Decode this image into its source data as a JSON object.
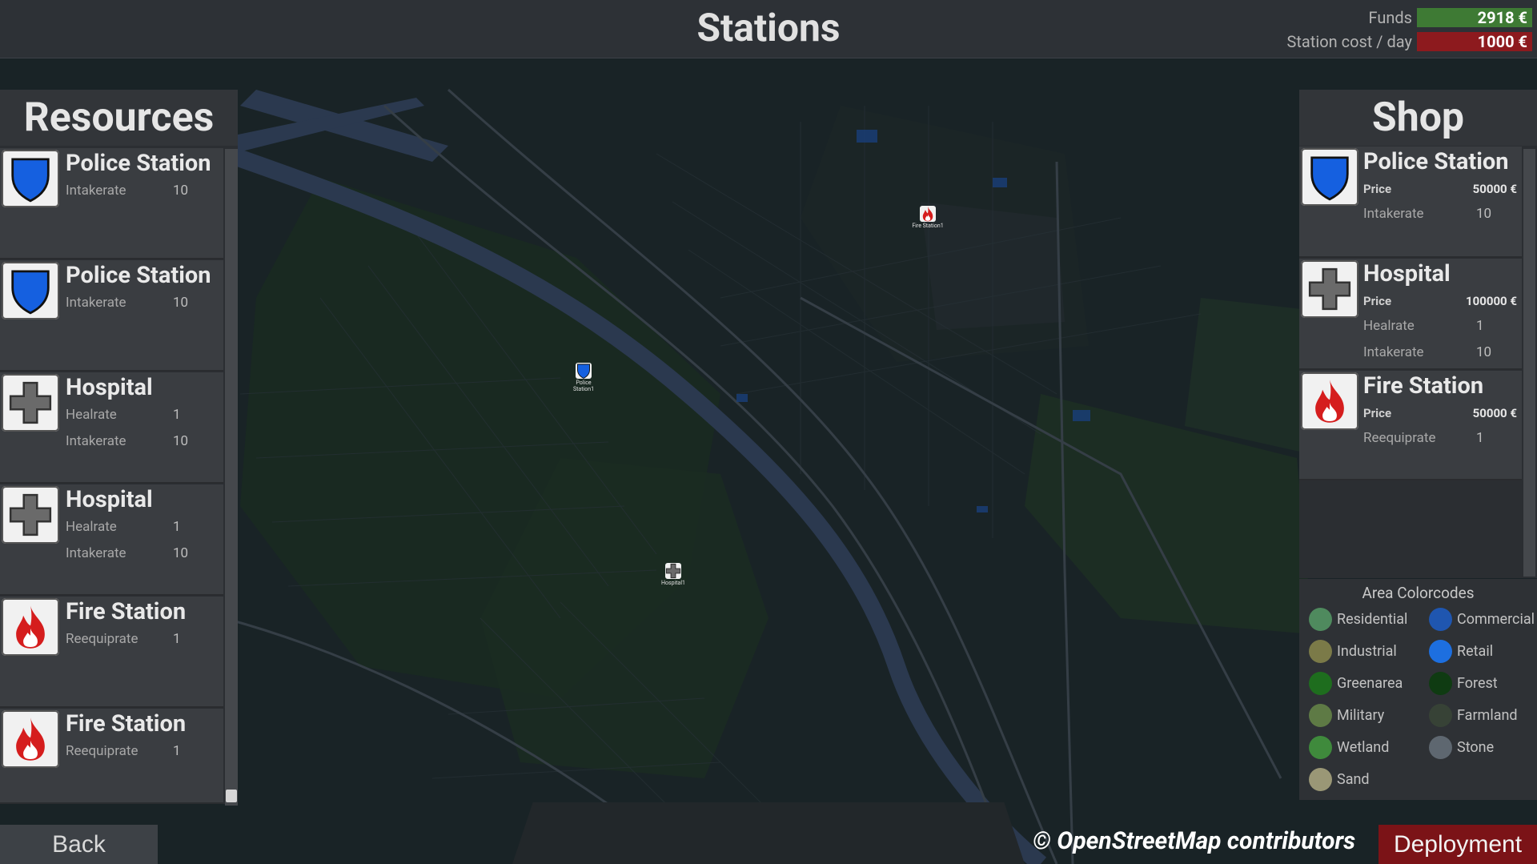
{
  "header": {
    "title": "Stations",
    "funds_label": "Funds",
    "funds_value": "2918 €",
    "cost_label": "Station cost / day",
    "cost_value": "1000 €"
  },
  "resources": {
    "title": "Resources",
    "items": [
      {
        "icon": "police-shield-icon",
        "name": "Police Station",
        "attrs": [
          {
            "label": "Intakerate",
            "value": "10"
          }
        ]
      },
      {
        "icon": "police-shield-icon",
        "name": "Police Station",
        "attrs": [
          {
            "label": "Intakerate",
            "value": "10"
          }
        ]
      },
      {
        "icon": "hospital-cross-icon",
        "name": "Hospital",
        "attrs": [
          {
            "label": "Healrate",
            "value": "1"
          },
          {
            "label": "Intakerate",
            "value": "10"
          }
        ]
      },
      {
        "icon": "hospital-cross-icon",
        "name": "Hospital",
        "attrs": [
          {
            "label": "Healrate",
            "value": "1"
          },
          {
            "label": "Intakerate",
            "value": "10"
          }
        ]
      },
      {
        "icon": "fire-flame-icon",
        "name": "Fire Station",
        "attrs": [
          {
            "label": "Reequiprate",
            "value": "1"
          }
        ]
      },
      {
        "icon": "fire-flame-icon",
        "name": "Fire Station",
        "attrs": [
          {
            "label": "Reequiprate",
            "value": "1"
          }
        ]
      }
    ]
  },
  "shop": {
    "title": "Shop",
    "items": [
      {
        "icon": "police-shield-icon",
        "name": "Police Station",
        "price_label": "Price",
        "price": "50000 €",
        "attrs": [
          {
            "label": "Intakerate",
            "value": "10"
          }
        ]
      },
      {
        "icon": "hospital-cross-icon",
        "name": "Hospital",
        "price_label": "Price",
        "price": "100000 €",
        "attrs": [
          {
            "label": "Healrate",
            "value": "1"
          },
          {
            "label": "Intakerate",
            "value": "10"
          }
        ]
      },
      {
        "icon": "fire-flame-icon",
        "name": "Fire Station",
        "price_label": "Price",
        "price": "50000 €",
        "attrs": [
          {
            "label": "Reequiprate",
            "value": "1"
          }
        ]
      }
    ]
  },
  "legend": {
    "title": "Area Colorcodes",
    "items": [
      {
        "label": "Residential",
        "color": "#4f8a5e"
      },
      {
        "label": "Commercial",
        "color": "#1f56b0"
      },
      {
        "label": "Industrial",
        "color": "#7b7a48"
      },
      {
        "label": "Retail",
        "color": "#1d6fe0"
      },
      {
        "label": "Greenarea",
        "color": "#1e6d1e"
      },
      {
        "label": "Forest",
        "color": "#0f3b12"
      },
      {
        "label": "Military",
        "color": "#5e7a45"
      },
      {
        "label": "Farmland",
        "color": "#374236"
      },
      {
        "label": "Wetland",
        "color": "#3f8a3c"
      },
      {
        "label": "Stone",
        "color": "#5e6770"
      },
      {
        "label": "Sand",
        "color": "#9a9776"
      }
    ]
  },
  "map_markers": [
    {
      "icon": "fire-flame-icon",
      "label": "Fire Station1"
    },
    {
      "icon": "police-shield-icon",
      "label": "Police Station1"
    },
    {
      "icon": "hospital-cross-icon",
      "label": "Hospital1"
    }
  ],
  "footer": {
    "back_label": "Back",
    "credit": "© OpenStreetMap contributors",
    "deploy_label": "Deployment"
  }
}
